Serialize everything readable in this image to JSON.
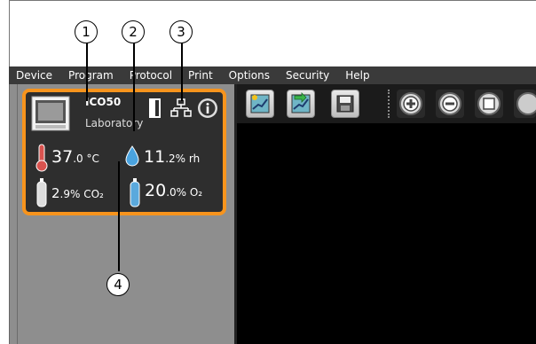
{
  "menu": {
    "items": [
      "Device",
      "Program",
      "Protocol",
      "Print",
      "Options",
      "Security",
      "Help"
    ]
  },
  "device_card": {
    "name": "ICO50",
    "location": "Laboratory",
    "temperature_value": "37",
    "temperature_unit": ".0 °C",
    "humidity_value": "11",
    "humidity_unit": ".2% rh",
    "co2_value": "2",
    "co2_unit": ".9% CO₂",
    "o2_value": "20",
    "o2_unit": ".0% O₂",
    "accent_color": "#f7941d"
  },
  "callouts": [
    "1",
    "2",
    "3",
    "4"
  ],
  "icons": [
    "incubator-icon",
    "door-icon",
    "network-icon",
    "info-icon",
    "thermometer-icon",
    "water-drop-icon",
    "gas-bottle-co2-icon",
    "gas-bottle-o2-icon",
    "new-program-icon",
    "import-icon",
    "save-icon",
    "zoom-in-icon",
    "zoom-out-icon",
    "fit-icon"
  ]
}
